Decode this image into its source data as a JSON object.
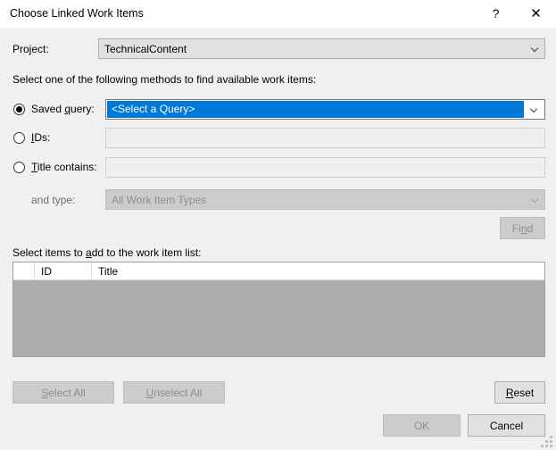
{
  "window": {
    "title": "Choose Linked Work Items",
    "help_glyph": "?",
    "close_glyph": "✕"
  },
  "project": {
    "label": "Project:",
    "value": "TechnicalContent"
  },
  "instruction": "Select one of the following methods to find available work items:",
  "methods": {
    "saved_query": {
      "label_pre": "Saved ",
      "label_accel": "q",
      "label_post": "uery:",
      "value": "<Select a Query>",
      "selected": true
    },
    "ids": {
      "label_accel": "I",
      "label_post": "Ds:",
      "value": "",
      "placeholder": "",
      "selected": false
    },
    "title_contains": {
      "label_accel": "T",
      "label_post": "itle contains:",
      "value": "",
      "placeholder": "",
      "selected": false
    },
    "and_type": {
      "label": "and type:",
      "value": "All Work Item Types"
    },
    "find_button": {
      "label_pre": "Fi",
      "label_accel": "n",
      "label_post": "d",
      "enabled": false
    }
  },
  "list_section": {
    "label_pre": "Select items to ",
    "label_accel": "a",
    "label_post": "dd to the work item list:",
    "columns": [
      "",
      "ID",
      "Title"
    ],
    "rows": []
  },
  "actions": {
    "select_all": {
      "label_accel": "S",
      "label_post": "elect All",
      "enabled": false
    },
    "unselect_all": {
      "label_accel": "U",
      "label_post": "nselect All",
      "enabled": false
    },
    "reset": {
      "label_accel": "R",
      "label_post": "eset",
      "enabled": true
    },
    "ok": {
      "label": "OK",
      "enabled": false
    },
    "cancel": {
      "label": "Cancel",
      "enabled": true
    }
  },
  "colors": {
    "dialog_bg": "#f0f0f0",
    "titlebar_bg": "#ffffff",
    "accent_selection": "#0078d7",
    "list_body": "#adadad",
    "control_bg": "#e1e1e1",
    "disabled_text": "#8d8d8d"
  }
}
